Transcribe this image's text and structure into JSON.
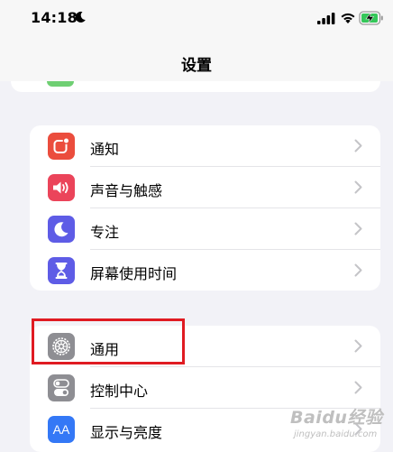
{
  "status_bar": {
    "time": "14:18",
    "icons": [
      "moon-icon",
      "signal-icon",
      "wifi-icon",
      "battery-charging-icon"
    ]
  },
  "nav": {
    "title": "设置"
  },
  "groups": [
    {
      "items": [
        {
          "label": "通知",
          "icon": "notification-icon",
          "color": "#eb4d3d"
        },
        {
          "label": "声音与触感",
          "icon": "speaker-icon",
          "color": "#eb445a"
        },
        {
          "label": "专注",
          "icon": "moon-icon",
          "color": "#5e5ce6"
        },
        {
          "label": "屏幕使用时间",
          "icon": "hourglass-icon",
          "color": "#5e5ce6"
        }
      ]
    },
    {
      "items": [
        {
          "label": "通用",
          "icon": "gear-icon",
          "color": "#8e8e93"
        },
        {
          "label": "控制中心",
          "icon": "toggle-icon",
          "color": "#8e8e93"
        },
        {
          "label": "显示与亮度",
          "icon": "text-size-icon",
          "color": "#3478f6",
          "icon_text": "AA"
        }
      ]
    }
  ],
  "highlight": {
    "target": "通用",
    "color": "#e01b22"
  },
  "watermark": {
    "main": "Baidu经验",
    "sub": "jingyan.baidu.com"
  }
}
